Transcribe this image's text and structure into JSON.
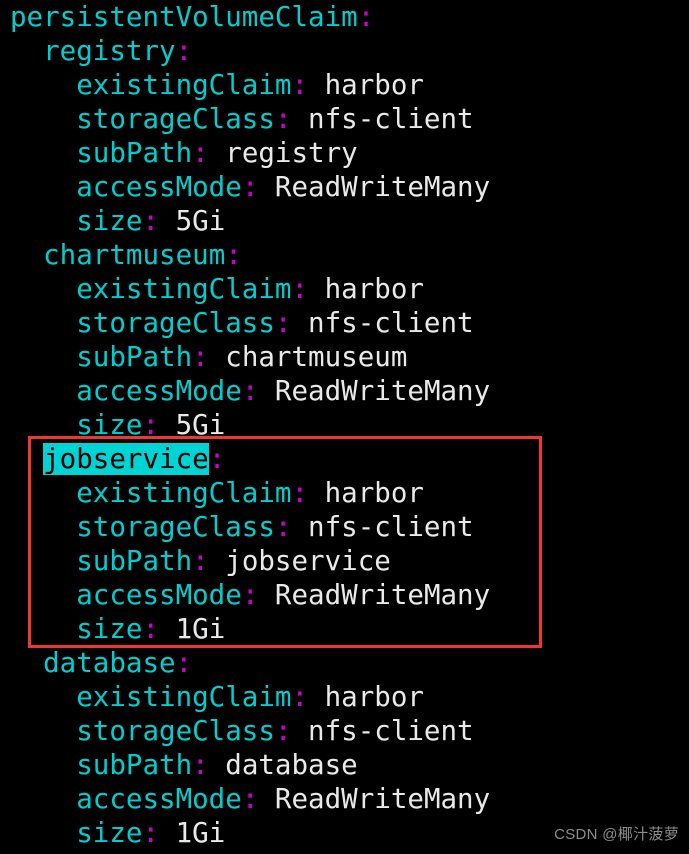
{
  "editor": {
    "background_color": "#000000",
    "key_color": "#00cdcd",
    "colon_color": "#cc00cc",
    "value_color": "#e9e9e9",
    "highlight_background_color": "#00d3d3",
    "highlight_text_color": "#000000",
    "annotation_box_color": "#f2352f"
  },
  "lines": [
    {
      "indent": "",
      "key": "persistentVolumeClaim",
      "colon": ":",
      "value": "",
      "highlighted": false
    },
    {
      "indent": "  ",
      "key": "registry",
      "colon": ":",
      "value": "",
      "highlighted": false
    },
    {
      "indent": "    ",
      "key": "existingClaim",
      "colon": ":",
      "value": " harbor",
      "highlighted": false
    },
    {
      "indent": "    ",
      "key": "storageClass",
      "colon": ":",
      "value": " nfs-client",
      "highlighted": false
    },
    {
      "indent": "    ",
      "key": "subPath",
      "colon": ":",
      "value": " registry",
      "highlighted": false
    },
    {
      "indent": "    ",
      "key": "accessMode",
      "colon": ":",
      "value": " ReadWriteMany",
      "highlighted": false
    },
    {
      "indent": "    ",
      "key": "size",
      "colon": ":",
      "value": " 5Gi",
      "highlighted": false
    },
    {
      "indent": "  ",
      "key": "chartmuseum",
      "colon": ":",
      "value": "",
      "highlighted": false
    },
    {
      "indent": "    ",
      "key": "existingClaim",
      "colon": ":",
      "value": " harbor",
      "highlighted": false
    },
    {
      "indent": "    ",
      "key": "storageClass",
      "colon": ":",
      "value": " nfs-client",
      "highlighted": false
    },
    {
      "indent": "    ",
      "key": "subPath",
      "colon": ":",
      "value": " chartmuseum",
      "highlighted": false
    },
    {
      "indent": "    ",
      "key": "accessMode",
      "colon": ":",
      "value": " ReadWriteMany",
      "highlighted": false
    },
    {
      "indent": "    ",
      "key": "size",
      "colon": ":",
      "value": " 5Gi",
      "highlighted": false
    },
    {
      "indent": "  ",
      "key": "jobservice",
      "colon": ":",
      "value": "",
      "highlighted": true
    },
    {
      "indent": "    ",
      "key": "existingClaim",
      "colon": ":",
      "value": " harbor",
      "highlighted": false
    },
    {
      "indent": "    ",
      "key": "storageClass",
      "colon": ":",
      "value": " nfs-client",
      "highlighted": false
    },
    {
      "indent": "    ",
      "key": "subPath",
      "colon": ":",
      "value": " jobservice",
      "highlighted": false
    },
    {
      "indent": "    ",
      "key": "accessMode",
      "colon": ":",
      "value": " ReadWriteMany",
      "highlighted": false
    },
    {
      "indent": "    ",
      "key": "size",
      "colon": ":",
      "value": " 1Gi",
      "highlighted": false
    },
    {
      "indent": "  ",
      "key": "database",
      "colon": ":",
      "value": "",
      "highlighted": false
    },
    {
      "indent": "    ",
      "key": "existingClaim",
      "colon": ":",
      "value": " harbor",
      "highlighted": false
    },
    {
      "indent": "    ",
      "key": "storageClass",
      "colon": ":",
      "value": " nfs-client",
      "highlighted": false
    },
    {
      "indent": "    ",
      "key": "subPath",
      "colon": ":",
      "value": " database",
      "highlighted": false
    },
    {
      "indent": "    ",
      "key": "accessMode",
      "colon": ":",
      "value": " ReadWriteMany",
      "highlighted": false
    },
    {
      "indent": "    ",
      "key": "size",
      "colon": ":",
      "value": " 1Gi",
      "highlighted": false
    }
  ],
  "watermark": {
    "text": "CSDN @椰汁菠萝"
  }
}
